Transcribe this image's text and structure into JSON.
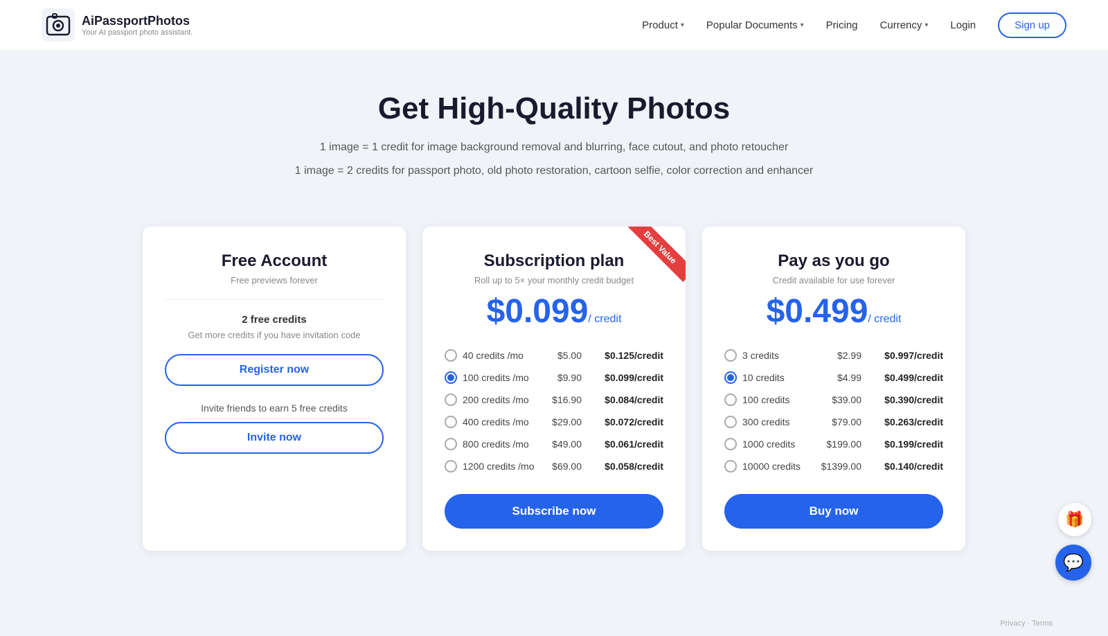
{
  "header": {
    "logo_name": "AiPassportPhotos",
    "logo_tagline": "Your AI passport photo assistant.",
    "nav": {
      "product": "Product",
      "popular_documents": "Popular Documents",
      "pricing": "Pricing",
      "currency": "Currency",
      "login": "Login",
      "signup": "Sign up"
    }
  },
  "hero": {
    "title": "Get High-Quality Photos",
    "line1": "1 image = 1 credit for image background removal and blurring, face cutout, and photo retoucher",
    "line2": "1 image = 2 credits for passport photo, old photo restoration, cartoon selfie, color correction and enhancer"
  },
  "cards": {
    "free": {
      "title": "Free Account",
      "subtitle": "Free previews forever",
      "credits_label": "2 free credits",
      "credits_sub": "Get more credits if you have invitation code",
      "register_btn": "Register now",
      "invite_text": "Invite friends to earn 5 free credits",
      "invite_btn": "Invite now"
    },
    "subscription": {
      "title": "Subscription plan",
      "subtitle": "Roll up to 5× your monthly credit budget",
      "badge": "Best Value",
      "price_main": "$0.099",
      "price_unit": "/ credit",
      "options": [
        {
          "label": "40 credits /mo",
          "price": "$5.00",
          "per": "$0.125/credit",
          "selected": false
        },
        {
          "label": "100 credits /mo",
          "price": "$9.90",
          "per": "$0.099/credit",
          "selected": true
        },
        {
          "label": "200 credits /mo",
          "price": "$16.90",
          "per": "$0.084/credit",
          "selected": false
        },
        {
          "label": "400 credits /mo",
          "price": "$29.00",
          "per": "$0.072/credit",
          "selected": false
        },
        {
          "label": "800 credits /mo",
          "price": "$49.00",
          "per": "$0.061/credit",
          "selected": false
        },
        {
          "label": "1200 credits /mo",
          "price": "$69.00",
          "per": "$0.058/credit",
          "selected": false
        }
      ],
      "cta": "Subscribe now"
    },
    "payg": {
      "title": "Pay as you go",
      "subtitle": "Credit available for use forever",
      "price_main": "$0.499",
      "price_unit": "/ credit",
      "options": [
        {
          "label": "3 credits",
          "price": "$2.99",
          "per": "$0.997/credit",
          "selected": false
        },
        {
          "label": "10 credits",
          "price": "$4.99",
          "per": "$0.499/credit",
          "selected": true
        },
        {
          "label": "100 credits",
          "price": "$39.00",
          "per": "$0.390/credit",
          "selected": false
        },
        {
          "label": "300 credits",
          "price": "$79.00",
          "per": "$0.263/credit",
          "selected": false
        },
        {
          "label": "1000 credits",
          "price": "$199.00",
          "per": "$0.199/credit",
          "selected": false
        },
        {
          "label": "10000 credits",
          "price": "$1399.00",
          "per": "$0.140/credit",
          "selected": false
        }
      ],
      "cta": "Buy now"
    }
  },
  "widgets": {
    "gift_icon": "🎁",
    "chat_icon": "💬"
  },
  "privacy": "Privacy · Terms"
}
